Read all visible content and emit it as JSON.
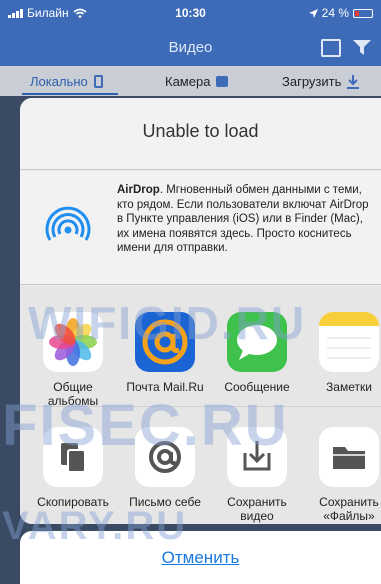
{
  "status_bar": {
    "carrier": "Билайн",
    "time": "10:30",
    "battery": "24 %"
  },
  "navbar": {
    "title": "Видео"
  },
  "segments": [
    {
      "label": "Локально"
    },
    {
      "label": "Камера"
    },
    {
      "label": "Загрузить"
    }
  ],
  "sheet": {
    "title": "Unable to load",
    "airdrop_title": "AirDrop",
    "airdrop_text": ". Мгновенный обмен данными с теми, кто рядом. Если пользователи включат AirDrop в Пункте управления (iOS) или в Finder (Mac), их имена появятся здесь. Просто коснитесь имени для отправки.",
    "apps": [
      {
        "label": "Общие альбомы",
        "icon": "photos-icon"
      },
      {
        "label": "Почта Mail.Ru",
        "icon": "mailru-icon"
      },
      {
        "label": "Сообщение",
        "icon": "messages-icon"
      },
      {
        "label": "Заметки",
        "icon": "notes-icon"
      }
    ],
    "actions": [
      {
        "label": "Скопировать",
        "icon": "copy-icon"
      },
      {
        "label": "Письмо себе",
        "icon": "at-icon"
      },
      {
        "label": "Сохранить видео",
        "icon": "save-video-icon"
      },
      {
        "label": "Сохранить «Файлы»",
        "icon": "folder-icon"
      }
    ],
    "cancel": "Отменить"
  },
  "watermarks": [
    "WIFIGID.RU",
    "FISEC.RU",
    "VARY.RU"
  ],
  "colors": {
    "accent": "#1a7ae0",
    "nav": "#3d6bb8"
  }
}
